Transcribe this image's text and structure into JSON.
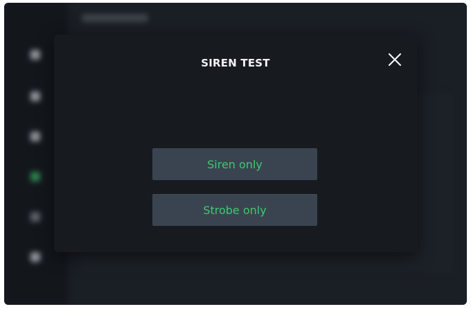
{
  "modal": {
    "title": "SIREN TEST",
    "close_icon": "close-icon",
    "buttons": [
      {
        "label": "Siren only"
      },
      {
        "label": "Strobe only"
      }
    ]
  },
  "colors": {
    "modal_background": "#171a1f",
    "button_background": "#3a4450",
    "button_text": "#3ec96f",
    "title_text": "#f2f4f7",
    "active_nav": "#3fbf6e"
  }
}
